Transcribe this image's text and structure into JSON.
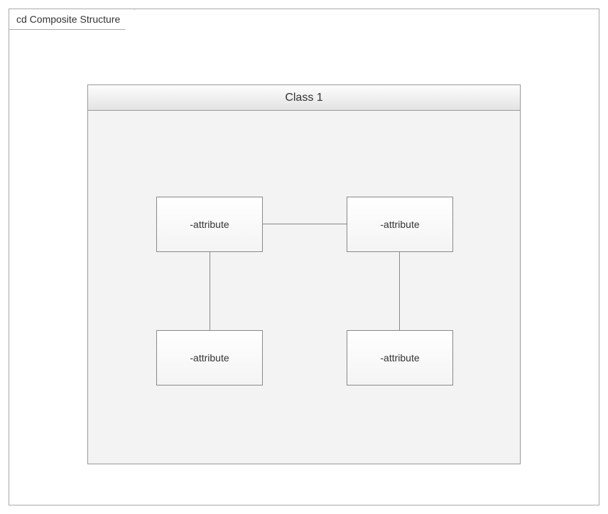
{
  "frame": {
    "title": "cd Composite Structure"
  },
  "class": {
    "name": "Class 1",
    "parts": [
      {
        "label": "-attribute"
      },
      {
        "label": "-attribute"
      },
      {
        "label": "-attribute"
      },
      {
        "label": "-attribute"
      }
    ]
  }
}
